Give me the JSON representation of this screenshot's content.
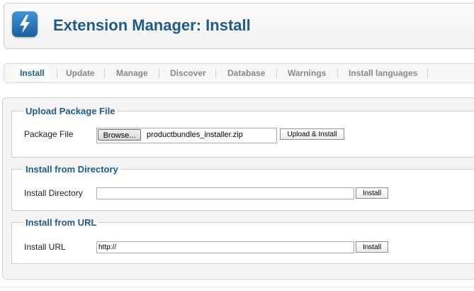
{
  "header": {
    "title": "Extension Manager: Install",
    "icon": "lightning-bolt-icon"
  },
  "tabs": [
    {
      "label": "Install",
      "active": true
    },
    {
      "label": "Update",
      "active": false
    },
    {
      "label": "Manage",
      "active": false
    },
    {
      "label": "Discover",
      "active": false
    },
    {
      "label": "Database",
      "active": false
    },
    {
      "label": "Warnings",
      "active": false
    },
    {
      "label": "Install languages",
      "active": false
    }
  ],
  "upload": {
    "legend": "Upload Package File",
    "field_label": "Package File",
    "browse_label": "Browse...",
    "file_name": "productbundles_installer.zip",
    "submit_label": "Upload & Install"
  },
  "directory": {
    "legend": "Install from Directory",
    "field_label": "Install Directory",
    "value": "",
    "submit_label": "Install"
  },
  "url": {
    "legend": "Install from URL",
    "field_label": "Install URL",
    "value": "http://",
    "submit_label": "Install"
  },
  "colors": {
    "accent": "#1d5b8d",
    "icon_bg": "#2a7bc0"
  }
}
